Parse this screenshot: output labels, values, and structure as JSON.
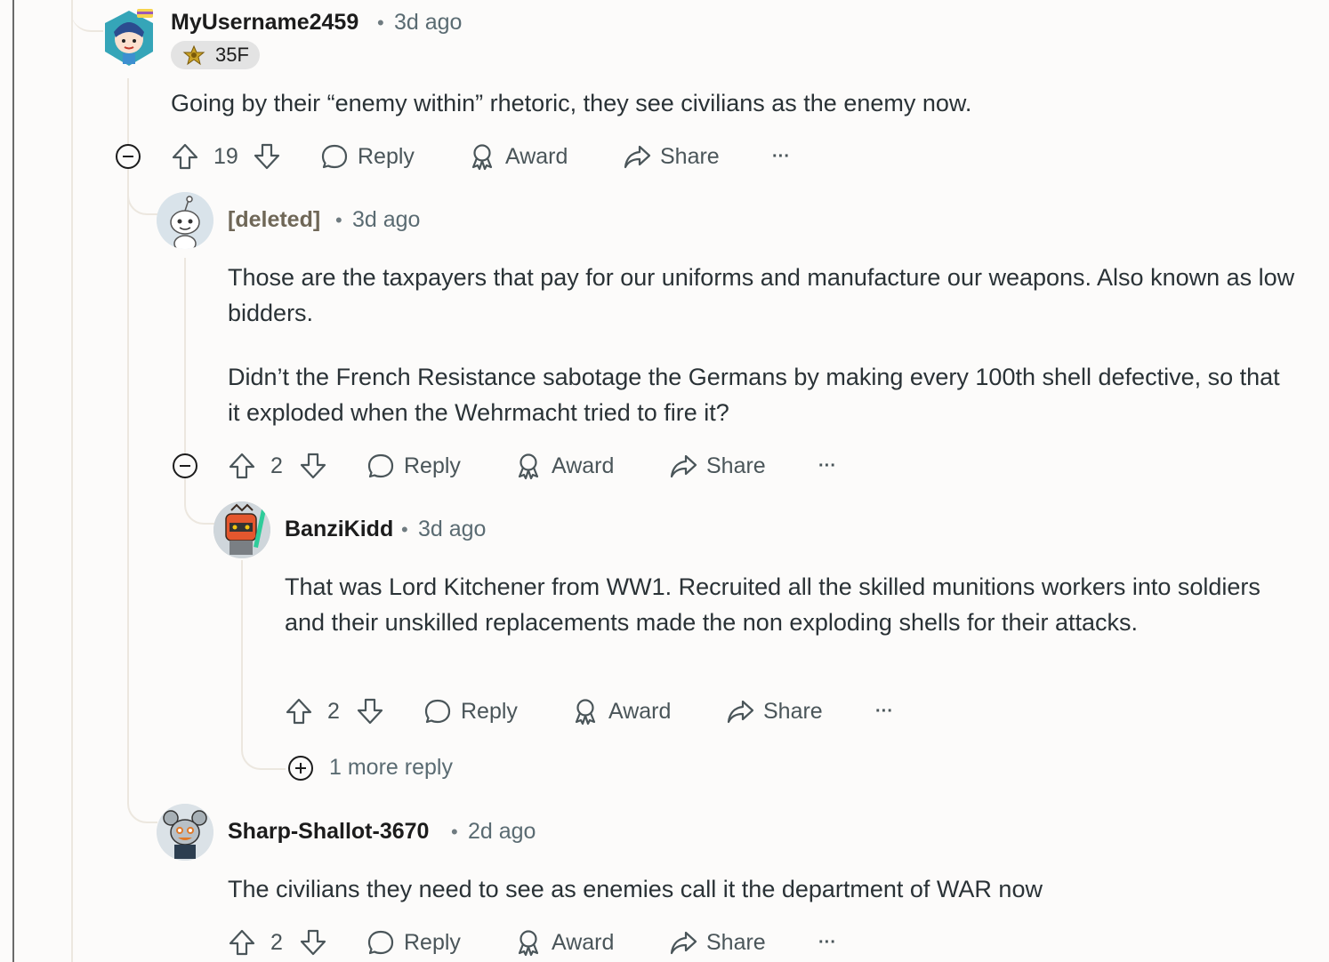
{
  "comments": [
    {
      "username": "MyUsername2459",
      "time": "3d ago",
      "flair": "35F",
      "body": [
        "Going by their “enemy within” rhetoric, they see civilians as the enemy now."
      ],
      "score": "19",
      "reply": "Reply",
      "award": "Award",
      "share": "Share",
      "more": "···"
    },
    {
      "username": "[deleted]",
      "time": "3d ago",
      "body": [
        "Those are the taxpayers that pay for our uniforms and manufacture our weapons.  Also known as low bidders.",
        "Didn’t the French Resistance sabotage the Germans by making every 100th shell defective, so that it exploded when the Wehrmacht tried to fire it?"
      ],
      "score": "2",
      "reply": "Reply",
      "award": "Award",
      "share": "Share",
      "more": "···"
    },
    {
      "username": "BanziKidd",
      "time": "3d ago",
      "body": [
        "That was Lord Kitchener from WW1. Recruited all the skilled munitions workers into soldiers and their unskilled replacements made the non exploding shells for their attacks."
      ],
      "score": "2",
      "reply": "Reply",
      "award": "Award",
      "share": "Share",
      "more": "···",
      "more_replies": "1 more reply"
    },
    {
      "username": "Sharp-Shallot-3670",
      "time": "2d ago",
      "body": [
        "The civilians they need to see as enemies call it the department of WAR now"
      ],
      "score": "2",
      "reply": "Reply",
      "award": "Award",
      "share": "Share",
      "more": "···"
    }
  ],
  "separator": "•",
  "colors": {
    "background": "#fcfbfa",
    "thread_line": "#ece7df",
    "text": "#2a3236",
    "meta": "#5a6b72"
  }
}
